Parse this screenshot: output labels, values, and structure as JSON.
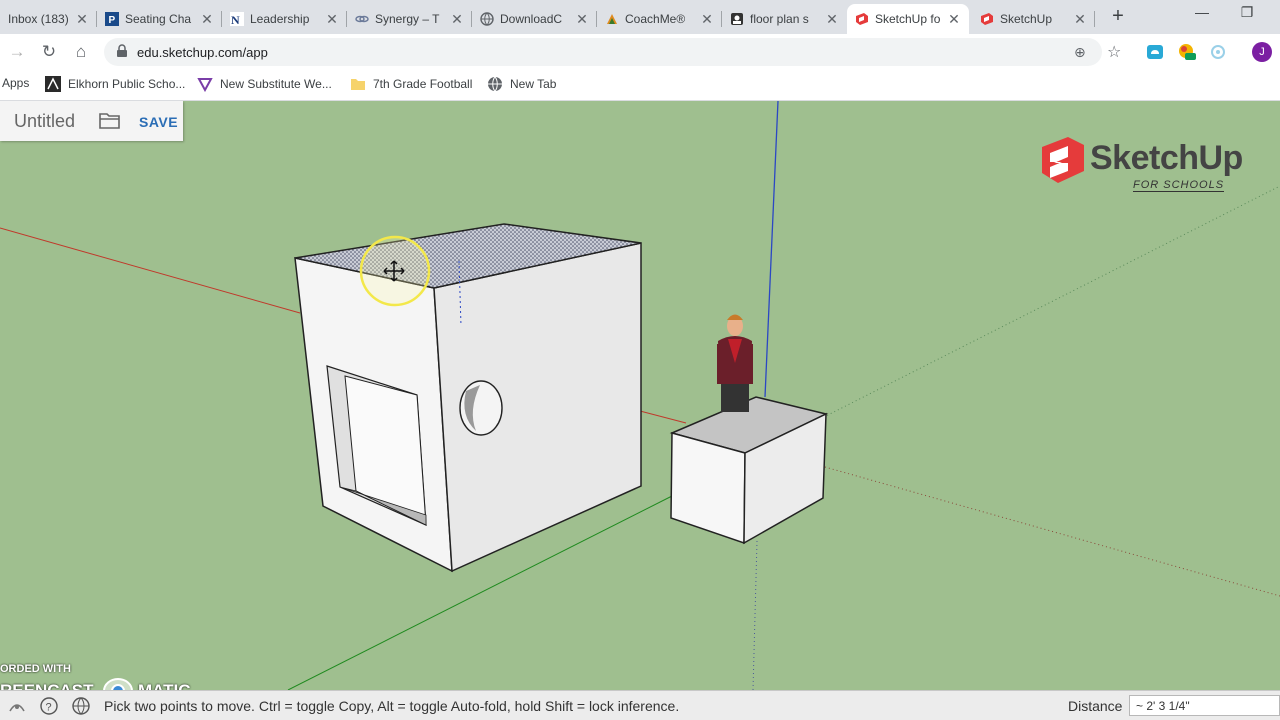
{
  "browser": {
    "tabs": [
      {
        "title": "Inbox (183)",
        "icon": "gmail-icon"
      },
      {
        "title": "Seating Cha",
        "icon": "p-logo-icon"
      },
      {
        "title": "Leadership",
        "icon": "n-logo-icon"
      },
      {
        "title": "Synergy – T",
        "icon": "link-icon"
      },
      {
        "title": "DownloadC",
        "icon": "globe-icon"
      },
      {
        "title": "CoachMe®",
        "icon": "coachme-icon"
      },
      {
        "title": "floor plan s",
        "icon": "image-icon"
      },
      {
        "title": "SketchUp fo",
        "icon": "sketchup-icon",
        "active": true
      },
      {
        "title": "SketchUp",
        "icon": "sketchup-icon"
      }
    ],
    "url": "edu.sketchup.com/app",
    "bookmarks": [
      {
        "label": "Apps",
        "icon": "apps-grid-icon"
      },
      {
        "label": "Elkhorn Public Scho...",
        "icon": "elkhorn-icon"
      },
      {
        "label": "New Substitute We...",
        "icon": "substitute-icon"
      },
      {
        "label": "7th Grade Football",
        "icon": "folder-icon"
      },
      {
        "label": "New Tab",
        "icon": "globe-icon"
      }
    ],
    "profile_initial": "J"
  },
  "app": {
    "file_name": "Untitled",
    "save_label": "SAVE",
    "logo_text": "SketchUp",
    "logo_subtext": "FOR SCHOOLS"
  },
  "watermark": {
    "line1": "ORDED WITH",
    "line2a": "REENCAST",
    "line2b": "MATIC"
  },
  "status": {
    "hint": "Pick two points to move. Ctrl = toggle Copy, Alt = toggle Auto-fold, hold Shift = lock inference.",
    "measure_label": "Distance",
    "measure_value": "~ 2' 3 1/4\""
  },
  "colors": {
    "viewport_bg": "#9fbf8f",
    "tab_strip": "#dee1e6",
    "save_blue": "#2a6db5",
    "sketchup_red": "#e53b3b"
  }
}
